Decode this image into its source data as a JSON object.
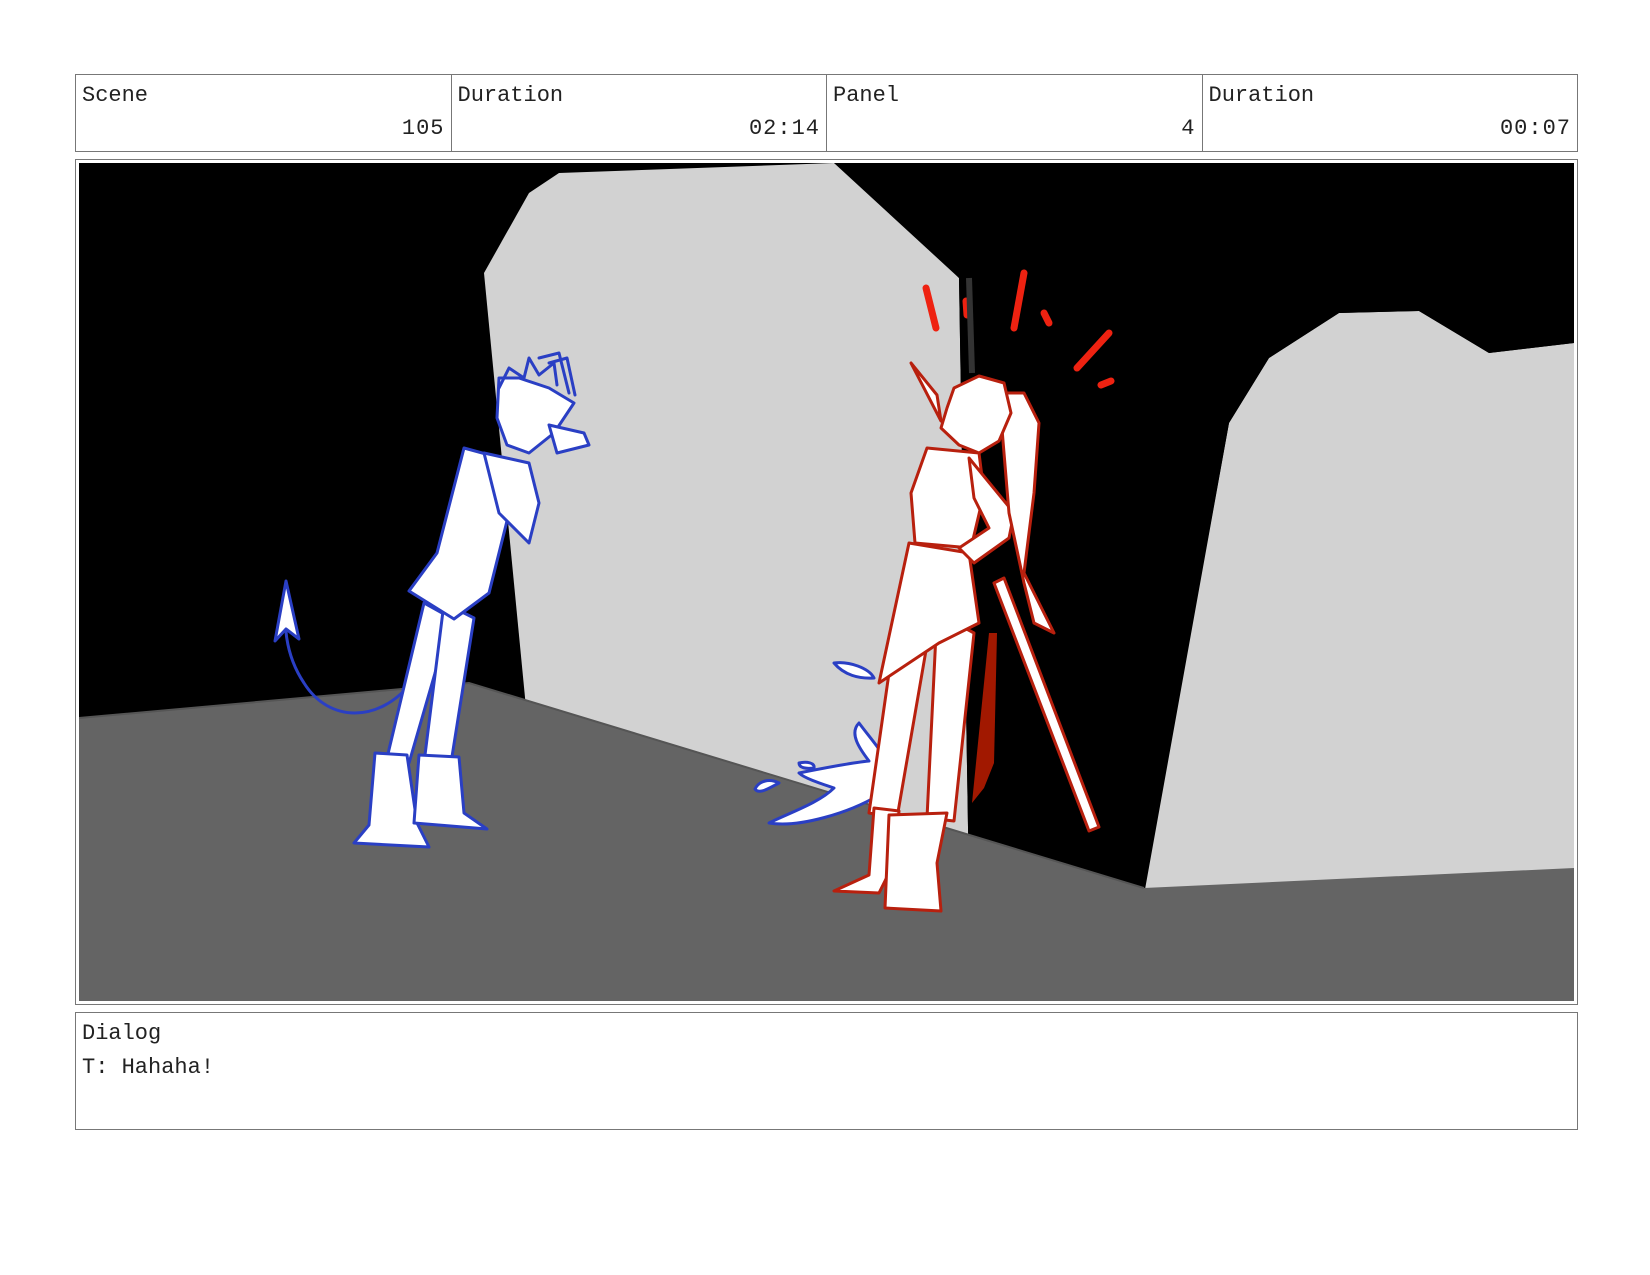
{
  "header": {
    "cells": [
      {
        "label": "Scene",
        "value": "105"
      },
      {
        "label": "Duration",
        "value": "02:14"
      },
      {
        "label": "Panel",
        "value": "4"
      },
      {
        "label": "Duration",
        "value": "00:07"
      }
    ]
  },
  "dialog": {
    "label": "Dialog",
    "text": "T: Hahaha!"
  },
  "colors": {
    "background_black": "#000000",
    "wall_gray": "#d2d2d2",
    "floor_gray": "#646464",
    "blue_character": "#2a3fc4",
    "red_character": "#b8200e",
    "accent_red": "#ee2211"
  }
}
